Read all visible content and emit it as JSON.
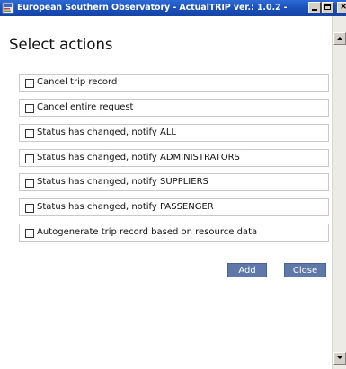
{
  "window": {
    "title": "European Southern Observatory - ActualTRIP ver.: 1.0.2 - ...",
    "icon": "app-icon"
  },
  "dialog": {
    "heading": "Select actions",
    "actions": [
      {
        "label": "Cancel trip record",
        "checked": false
      },
      {
        "label": "Cancel entire request",
        "checked": false
      },
      {
        "label": "Status has changed, notify ALL",
        "checked": false
      },
      {
        "label": "Status has changed, notify ADMINISTRATORS",
        "checked": false
      },
      {
        "label": "Status has changed, notify SUPPLIERS",
        "checked": false
      },
      {
        "label": "Status has changed, notify PASSENGER",
        "checked": false
      },
      {
        "label": "Autogenerate trip record based on resource data",
        "checked": false
      }
    ],
    "buttons": {
      "add_label": "Add",
      "close_label": "Close"
    }
  },
  "colors": {
    "titlebar": "#1a4fb8",
    "button": "#5e78a8"
  }
}
